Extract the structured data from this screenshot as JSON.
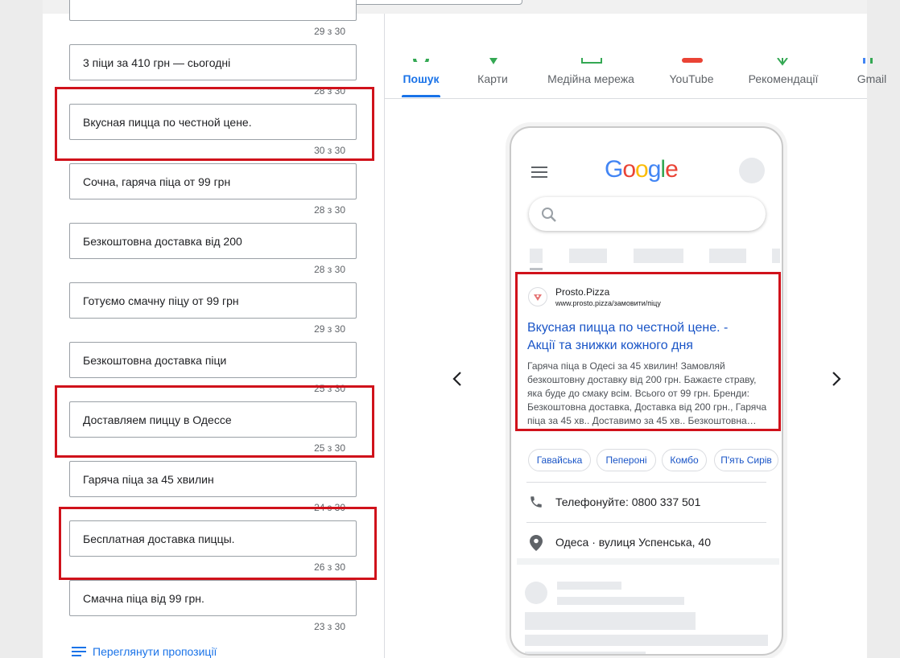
{
  "headlines": [
    {
      "text": "",
      "count": "29 з 30"
    },
    {
      "text": "3 піци за 410 грн — сьогодні",
      "count": "28 з 30"
    },
    {
      "text": "Вкусная пицца по честной цене.",
      "count": "30 з 30"
    },
    {
      "text": "Сочна, гаряча піца от 99 грн",
      "count": "28 з 30"
    },
    {
      "text": "Безкоштовна доставка від 200",
      "count": "28 з 30"
    },
    {
      "text": "Готуємо смачну піцу от 99 грн",
      "count": "29 з 30"
    },
    {
      "text": "Безкоштовна доставка піци",
      "count": "25 з 30"
    },
    {
      "text": "Доставляем пиццу в Одессе",
      "count": "25 з 30"
    },
    {
      "text": "Гаряча піца за 45 хвилин",
      "count": "24 з 30"
    },
    {
      "text": "Бесплатная доставка пиццы.",
      "count": "26 з 30"
    },
    {
      "text": "Смачна піца від 99 грн.",
      "count": "23 з 30"
    }
  ],
  "view_suggestions": "Переглянути пропозиції",
  "tabs": [
    {
      "label": "Пошук",
      "active": true
    },
    {
      "label": "Карти",
      "active": false
    },
    {
      "label": "Медійна мережа",
      "active": false
    },
    {
      "label": "YouTube",
      "active": false
    },
    {
      "label": "Рекомендації",
      "active": false
    },
    {
      "label": "Gmail",
      "active": false
    }
  ],
  "preview": {
    "logo_letters": [
      "G",
      "o",
      "o",
      "g",
      "l",
      "e"
    ],
    "logo_colors": [
      "#4285f4",
      "#ea4335",
      "#fbbc05",
      "#4285f4",
      "#34a853",
      "#ea4335"
    ],
    "ad": {
      "advertiser": "Prosto.Pizza",
      "url": "www.prosto.pizza/замовити/піцу",
      "title_line1": "Вкусная пицца по честной цене. -",
      "title_line2": "Акції та знижки кожного дня",
      "description": "Гаряча піца в Одесі за 45 хвилин! Замовляй безкоштовну доставку від 200 грн. Бажаєте страву, яка буде до смаку всім. Всього от 99 грн. Бренди: Безкоштовна доставка, Доставка від 200 грн., Гаряча піца за 45 хв.. Доставимо за 45 хв.. Безкоштовна…"
    },
    "sitelinks": [
      "Гавайська",
      "Пепероні",
      "Комбо",
      "П'ять Сирів"
    ],
    "call": "Телефонуйте: 0800 337 501",
    "location": "Одеса · вулиця Успенська, 40"
  },
  "icons": {
    "menu": "hamburger-icon",
    "search": "magnifier-icon",
    "phone": "phone-icon",
    "location": "location-pin-icon",
    "prev": "chevron-left-icon",
    "next": "chevron-right-icon"
  },
  "colors": {
    "accent": "#1a73e8",
    "highlight": "#d0121b",
    "ad_link": "#1a55c7"
  }
}
